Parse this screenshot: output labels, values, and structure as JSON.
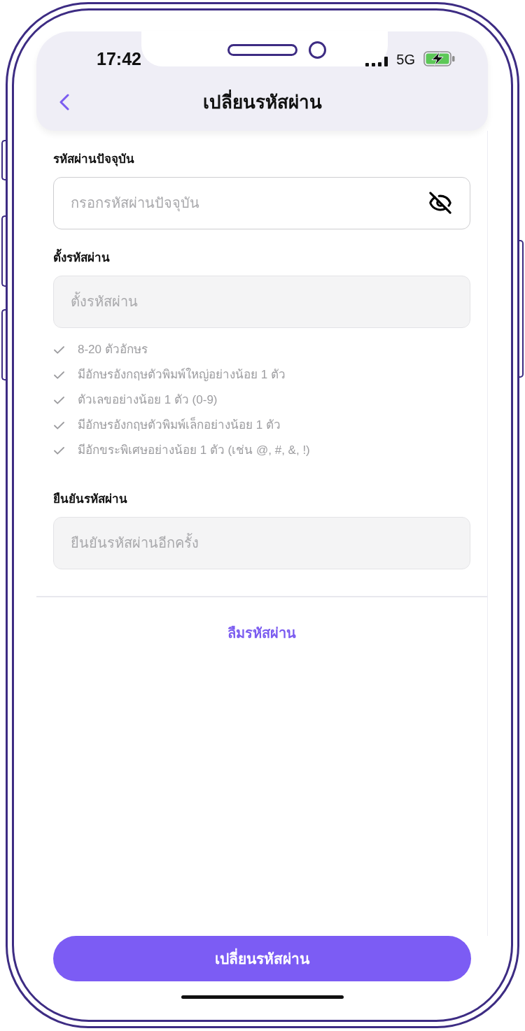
{
  "status_bar": {
    "time": "17:42",
    "network": "5G"
  },
  "header": {
    "title": "เปลี่ยนรหัสผ่าน"
  },
  "fields": [
    {
      "label": "รหัสผ่านปัจจุบัน",
      "placeholder": "กรอกรหัสผ่านปัจจุบัน",
      "disabled": false,
      "visibility_toggle": true
    },
    {
      "label": "ตั้งรหัสผ่าน",
      "placeholder": "ตั้งรหัสผ่าน",
      "disabled": true,
      "visibility_toggle": false,
      "rules": [
        {
          "text": "8-20 ตัวอักษร",
          "met": false
        },
        {
          "text": "มีอักษรอังกฤษตัวพิมพ์ใหญ่อย่างน้อย 1 ตัว",
          "met": false
        },
        {
          "text": "ตัวเลขอย่างน้อย 1 ตัว (0-9)",
          "met": false
        },
        {
          "text": "มีอักษรอังกฤษตัวพิมพ์เล็กอย่างน้อย 1 ตัว",
          "met": false
        },
        {
          "text": "มีอักขระพิเศษอย่างน้อย 1 ตัว (เช่น @, #, &, !)",
          "met": false
        }
      ]
    },
    {
      "label": "ยืนยันรหัสผ่าน",
      "placeholder": "ยืนยันรหัสผ่านอีกครั้ง",
      "disabled": true,
      "visibility_toggle": false
    }
  ],
  "forgot_password_link": "ลืมรหัสผ่าน",
  "submit_button": "เปลี่ยนรหัสผ่าน"
}
